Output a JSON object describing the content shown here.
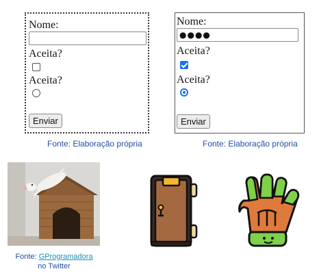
{
  "form_unstyled": {
    "name_label": "Nome:",
    "name_value": "",
    "checkbox_label": "Aceita?",
    "checkbox_checked": false,
    "radio_label": "Aceita?",
    "radio_checked": false,
    "submit_label": "Enviar",
    "caption": "Fonte: Elaboração própria"
  },
  "form_filled": {
    "name_label": "Nome:",
    "name_value": "●●●●",
    "checkbox_label": "Aceita?",
    "checkbox_checked": true,
    "radio_label": "Aceita?",
    "radio_checked": true,
    "submit_label": "Enviar",
    "caption": "Fonte: Elaboração própria"
  },
  "photo": {
    "caption_prefix": "Fonte: ",
    "caption_link": "GProgramadora",
    "caption_suffix": "no Twitter"
  },
  "icons": {
    "door": "door-icon",
    "glove": "glove-icon"
  },
  "colors": {
    "checked_accent": "#1a73e8",
    "caption_text": "#1f4fa0",
    "link": "#1a8fb8"
  }
}
